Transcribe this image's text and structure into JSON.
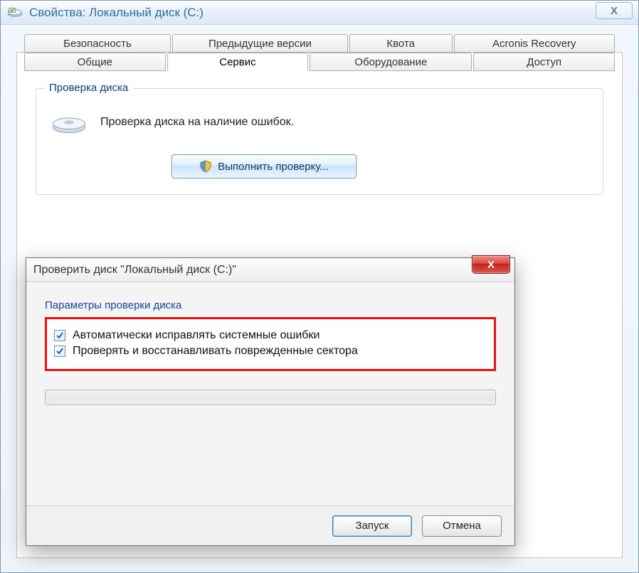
{
  "outer": {
    "title": "Свойства: Локальный диск (C:)",
    "close_glyph": "X",
    "tabs_top": [
      "Безопасность",
      "Предыдущие версии",
      "Квота",
      "Acronis Recovery"
    ],
    "tabs_second": [
      "Общие",
      "Сервис",
      "Оборудование",
      "Доступ"
    ],
    "active_tab": "Сервис",
    "group": {
      "legend": "Проверка диска",
      "desc": "Проверка диска на наличие ошибок.",
      "button": "Выполнить проверку..."
    }
  },
  "inner": {
    "title": "Проверить диск \"Локальный диск (C:)\"",
    "close_glyph": "X",
    "params_legend": "Параметры проверки диска",
    "checks": [
      "Автоматически исправлять системные ошибки",
      "Проверять и восстанавливать поврежденные сектора"
    ],
    "start": "Запуск",
    "cancel": "Отмена"
  }
}
